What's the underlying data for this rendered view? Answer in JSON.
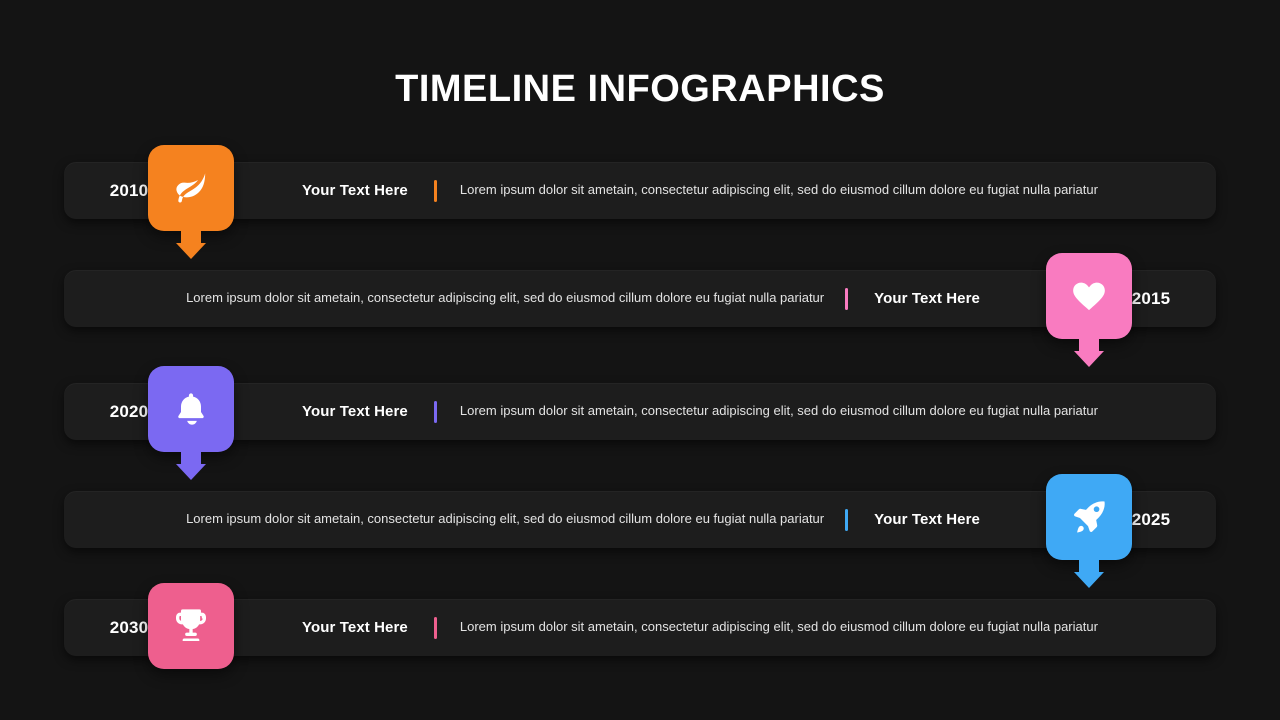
{
  "page": {
    "title": "TIMELINE INFOGRAPHICS",
    "background_color": "#141414",
    "bar_color": "#1D1D1D"
  },
  "timeline": {
    "items": [
      {
        "year": "2010",
        "heading": "Your Text Here",
        "body": "Lorem ipsum dolor sit ametain, consectetur  adipiscing elit, sed do eiusmod  cillum dolore eu fugiat nulla  pariatur",
        "color": "#F5821F",
        "icon": "leaf-icon",
        "align": "left",
        "has_arrow": true
      },
      {
        "year": "2015",
        "heading": "Your Text Here",
        "body": "Lorem ipsum dolor sit ametain, consectetur  adipiscing elit, sed do eiusmod  cillum dolore eu fugiat nulla  pariatur",
        "color": "#F97BC0",
        "icon": "heart-icon",
        "align": "right",
        "has_arrow": true
      },
      {
        "year": "2020",
        "heading": "Your Text Here",
        "body": "Lorem ipsum dolor sit ametain, consectetur  adipiscing elit, sed do eiusmod  cillum dolore eu fugiat nulla  pariatur",
        "color": "#7B69F2",
        "icon": "bell-icon",
        "align": "left",
        "has_arrow": true
      },
      {
        "year": "2025",
        "heading": "Your Text Here",
        "body": "Lorem ipsum dolor sit ametain, consectetur  adipiscing elit, sed do eiusmod  cillum dolore eu fugiat nulla  pariatur",
        "color": "#3FA9F5",
        "icon": "rocket-icon",
        "align": "right",
        "has_arrow": true
      },
      {
        "year": "2030",
        "heading": "Your Text Here",
        "body": "Lorem ipsum dolor sit ametain, consectetur  adipiscing elit, sed do eiusmod  cillum dolore eu fugiat nulla  pariatur",
        "color": "#EE5F8E",
        "icon": "trophy-icon",
        "align": "left",
        "has_arrow": false
      }
    ]
  }
}
